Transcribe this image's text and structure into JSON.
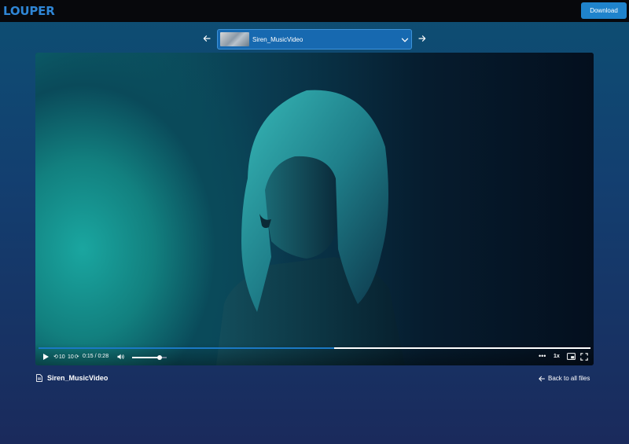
{
  "app": {
    "logo_text": "LOUPER",
    "brand_color": "#2f86d6",
    "download_label": "Download"
  },
  "file_nav": {
    "prev_icon": "arrow-left-icon",
    "next_icon": "arrow-right-icon",
    "selected_file": "Siren_MusicVideo",
    "dropdown_icon": "chevron-down-icon"
  },
  "player": {
    "progress_fraction": 0.5357,
    "rewind_label": "10",
    "forward_label": "10",
    "time_display": "0:15 / 0:28",
    "volume_fraction": 0.8,
    "speed_label": "1x",
    "more_label": "•••",
    "icons": {
      "play": "play-icon",
      "rewind": "rewind-10-icon",
      "forward": "forward-10-icon",
      "volume": "volume-icon",
      "more": "more-options-icon",
      "pip": "picture-in-picture-icon",
      "fullscreen": "fullscreen-icon"
    }
  },
  "footer": {
    "file_icon": "document-icon",
    "file_name": "Siren_MusicVideo",
    "back_icon": "arrow-left-icon",
    "back_label": "Back to all files"
  }
}
